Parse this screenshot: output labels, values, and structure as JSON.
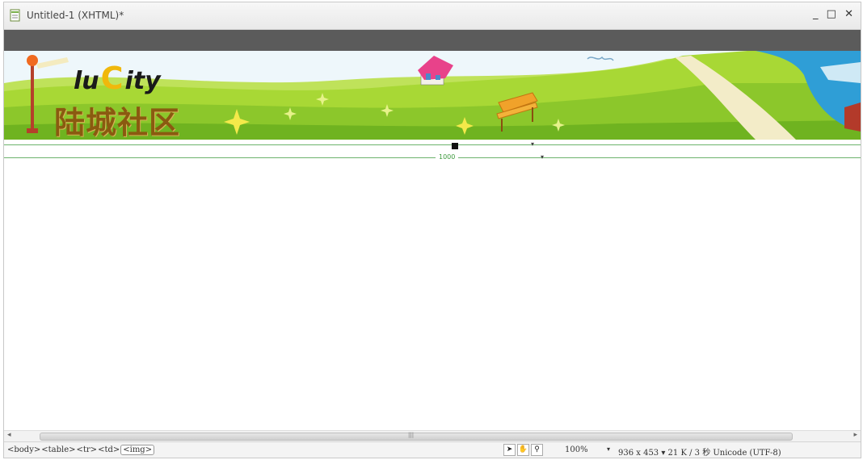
{
  "window": {
    "title": "Untitled-1 (XHTML)*",
    "controls": [
      "_",
      "□",
      "✕"
    ]
  },
  "banner": {
    "logo_prefix": "lu",
    "logo_c": "C",
    "logo_suffix": "ity",
    "logo_cn": "陆城社区"
  },
  "ruler": {
    "width_label": "1000"
  },
  "statusbar": {
    "tags": [
      "<body>",
      "<table>",
      "<tr>",
      "<td>",
      "<img>"
    ],
    "zoom": "100%",
    "size_info": "936 x 453 ▾ 21 K / 3 秒 Unicode (UTF-8)"
  },
  "colors": {
    "grass_light": "#a8d835",
    "grass_dark": "#6fb320",
    "sky": "#e8f4fb",
    "house_roof": "#e8428a",
    "logo_c": "#f0b80c"
  }
}
